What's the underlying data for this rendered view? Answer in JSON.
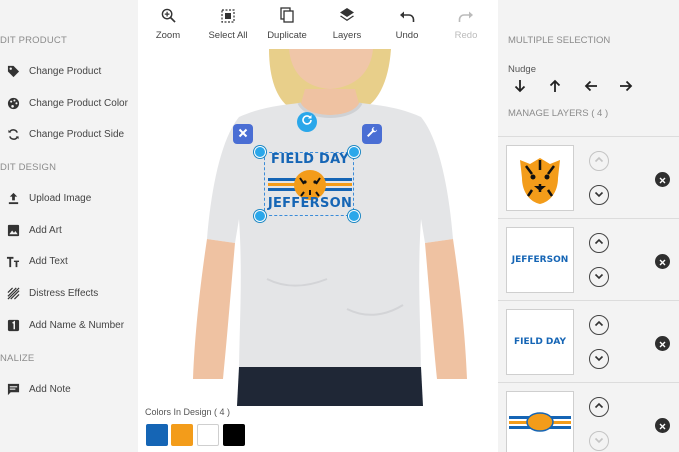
{
  "left_panel": {
    "product_heading": "DIT PRODUCT",
    "product_items": [
      {
        "label": "Change Product",
        "icon": "tag-icon"
      },
      {
        "label": "Change Product Color",
        "icon": "palette-icon"
      },
      {
        "label": "Change Product Side",
        "icon": "sync-icon"
      }
    ],
    "design_heading": "DIT DESIGN",
    "design_items": [
      {
        "label": "Upload Image",
        "icon": "upload-icon"
      },
      {
        "label": "Add Art",
        "icon": "image-icon"
      },
      {
        "label": "Add Text",
        "icon": "text-icon"
      },
      {
        "label": "Distress Effects",
        "icon": "texture-icon"
      },
      {
        "label": "Add Name & Number",
        "icon": "number-one-icon"
      }
    ],
    "finalize_heading": "NALIZE",
    "finalize_items": [
      {
        "label": "Add Note",
        "icon": "note-icon"
      }
    ]
  },
  "toolbar": {
    "zoom": "Zoom",
    "select_all": "Select All",
    "duplicate": "Duplicate",
    "layers": "Layers",
    "undo": "Undo",
    "redo": "Redo"
  },
  "design": {
    "line1": "FIELD DAY",
    "line2": "JEFFERSON"
  },
  "colors": {
    "label": "Colors In Design ( 4 )",
    "swatches": [
      "#1565b5",
      "#f39c1a",
      "#ffffff",
      "#000000"
    ]
  },
  "right_panel": {
    "heading": "MULTIPLE SELECTION",
    "nudge_label": "Nudge",
    "nudge_icons": [
      "arrow-down-icon",
      "arrow-up-icon",
      "arrow-left-icon",
      "arrow-right-icon"
    ],
    "layers_label": "MANAGE LAYERS ( 4 )",
    "layers": [
      {
        "name": "tiger-layer",
        "text": ""
      },
      {
        "name": "jefferson-layer",
        "text": "JEFFERSON"
      },
      {
        "name": "field-day-layer",
        "text": "FIELD DAY"
      },
      {
        "name": "stripe-layer",
        "text": ""
      }
    ]
  },
  "accent_color": "#2aa7ea"
}
